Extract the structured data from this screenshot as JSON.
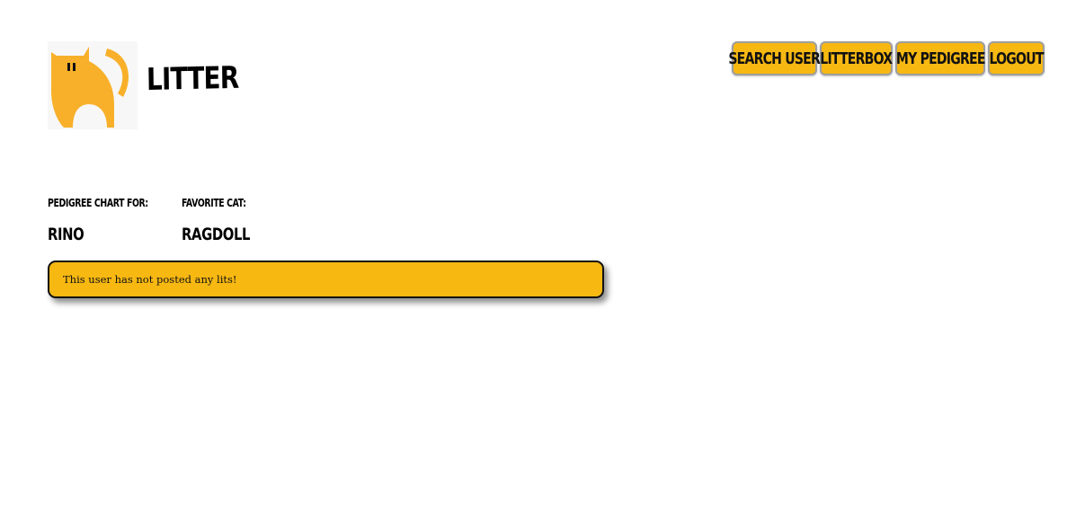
{
  "header": {
    "logo_icon": "cat-logo-icon",
    "title": "LITTER"
  },
  "nav": {
    "search_user": "SEARCH USER",
    "litterbox": "LITTERBOX",
    "my_pedigree": "MY PEDIGREE",
    "logout": "LOGOUT"
  },
  "profile": {
    "pedigree_label": "PEDIGREE CHART FOR:",
    "pedigree_value": "RINO",
    "favorite_label": "FAVORITE CAT:",
    "favorite_value": "RAGDOLL"
  },
  "lits": {
    "empty_message": "This user has not posted any lits!"
  },
  "colors": {
    "accent": "#f7b812",
    "logo": "#f8b02a",
    "logo_bg": "#f7f7f7",
    "border": "#111111"
  }
}
